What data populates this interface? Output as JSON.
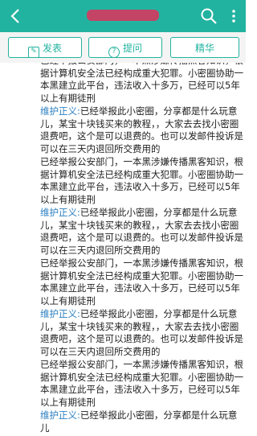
{
  "header": {
    "back_icon": "back-arrow-icon",
    "search_icon": "search-icon",
    "more_icon": "more-vertical-icon"
  },
  "actions": {
    "post_label": "发表",
    "ask_label": "提问",
    "featured_label": "精华"
  },
  "posts": [
    {
      "label": "",
      "text": "已经举报公安部门，一本黑涉嫌传播黑客知识，根据计算机安全法已经构成重大犯罪。小密圈协助一本黑建立此平台，违法收入十多万，已经可以5年以上有期徒刑"
    },
    {
      "label": "维护正义:",
      "text": "已经举报此小密圈，分享都是什么玩意儿，某宝十块钱买来的教程，，大家去去找小密圈退费吧，这个是可以退费的。也可以发邮件投诉是可以在三天内退回所交费用的"
    },
    {
      "label": "",
      "text": "已经举报公安部门，一本黑涉嫌传播黑客知识，根据计算机安全法已经构成重大犯罪。小密圈协助一本黑建立此平台，违法收入十多万，已经可以5年以上有期徒刑"
    },
    {
      "label": "维护正义:",
      "text": "已经举报此小密圈，分享都是什么玩意儿，某宝十块钱买来的教程，，大家去去找小密圈退费吧，这个是可以退费的。也可以发邮件投诉是可以在三天内退回所交费用的"
    },
    {
      "label": "",
      "text": "已经举报公安部门，一本黑涉嫌传播黑客知识，根据计算机安全法已经构成重大犯罪。小密圈协助一本黑建立此平台，违法收入十多万，已经可以5年以上有期徒刑"
    },
    {
      "label": "维护正义:",
      "text": "已经举报此小密圈，分享都是什么玩意儿，某宝十块钱买来的教程，，大家去去找小密圈退费吧，这个是可以退费的。也可以发邮件投诉是可以在三天内退回所交费用的"
    },
    {
      "label": "",
      "text": "已经举报公安部门，一本黑涉嫌传播黑客知识，根据计算机安全法已经构成重大犯罪。小密圈协助一本黑建立此平台，违法收入十多万，已经可以5年以上有期徒刑"
    },
    {
      "label": "维护正义:",
      "text": "已经举报此小密圈，分享都是什么玩意儿"
    }
  ]
}
